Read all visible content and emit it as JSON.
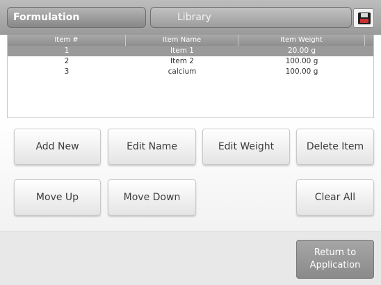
{
  "header": {
    "tabs": [
      {
        "label": "Formulation"
      },
      {
        "label": "Library"
      }
    ],
    "save_icon": "floppy-disk-icon"
  },
  "table": {
    "columns": [
      "Item #",
      "Item Name",
      "Item Weight",
      ""
    ],
    "rows": [
      {
        "num": "1",
        "name": "Item 1",
        "weight": "20.00 g",
        "selected": true
      },
      {
        "num": "2",
        "name": "Item 2",
        "weight": "100.00 g",
        "selected": false
      },
      {
        "num": "3",
        "name": "calcium",
        "weight": "100.00 g",
        "selected": false
      }
    ]
  },
  "buttons": {
    "add_new": "Add New",
    "edit_name": "Edit Name",
    "edit_weight": "Edit Weight",
    "delete_item": "Delete Item",
    "move_up": "Move Up",
    "move_down": "Move Down",
    "clear_all": "Clear All",
    "return_line1": "Return to",
    "return_line2": "Application"
  },
  "colors": {
    "header": "#9a9a9a",
    "selected_row": "#9a9a9a",
    "button_face": "#f2f2f2",
    "return_button": "#8a8a8a"
  }
}
